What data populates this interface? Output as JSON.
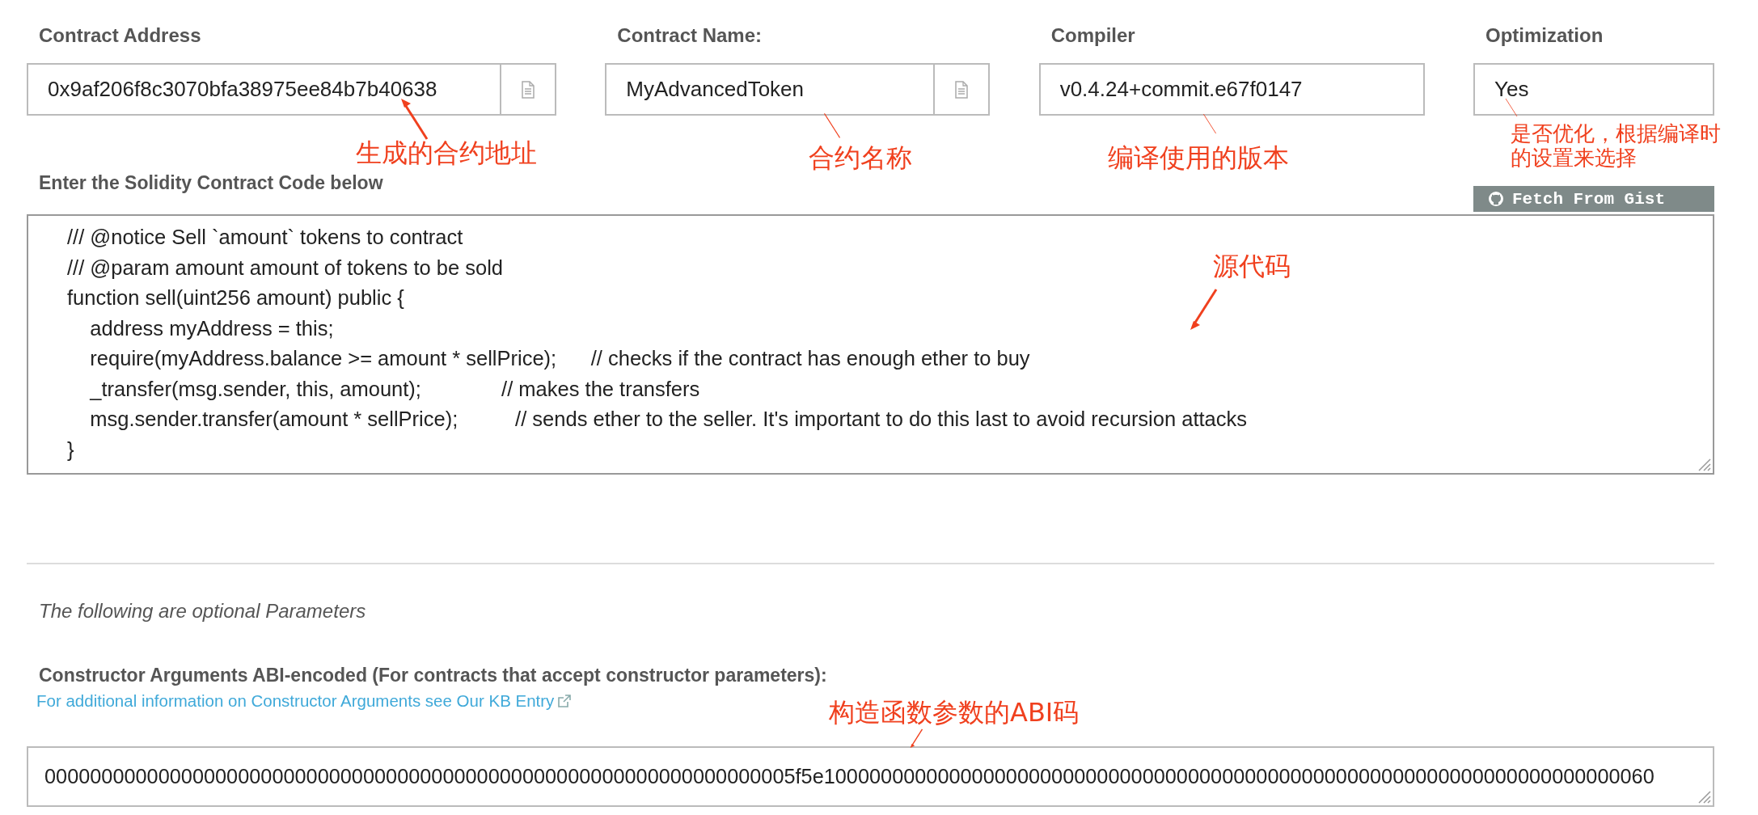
{
  "fields": [
    {
      "label": "Contract Address",
      "value": "0x9af206f8c3070bfa38975ee84b7b40638",
      "copy_button": true
    },
    {
      "label": "Contract Name:",
      "value": "MyAdvancedToken",
      "copy_button": true
    },
    {
      "label": "Compiler",
      "value": "v0.4.24+commit.e67f0147",
      "copy_button": false
    },
    {
      "label": "Optimization",
      "value": "Yes",
      "copy_button": false
    }
  ],
  "code_section": {
    "label": "Enter the Solidity Contract Code below",
    "gist_button": "Fetch From Gist",
    "lines": [
      "/// @notice Sell `amount` tokens to contract",
      "/// @param amount amount of tokens to be sold",
      "function sell(uint256 amount) public {",
      "    address myAddress = this;",
      "    require(myAddress.balance >= amount * sellPrice);      // checks if the contract has enough ether to buy",
      "    _transfer(msg.sender, this, amount);              // makes the transfers",
      "    msg.sender.transfer(amount * sellPrice);          // sends ether to the seller. It's important to do this last to avoid recursion attacks",
      "}"
    ]
  },
  "optional_note": "The following are optional Parameters",
  "constructor_args": {
    "label": "Constructor Arguments ABI-encoded (For contracts that accept constructor parameters):",
    "link": "For additional information on Constructor Arguments see Our KB Entry",
    "value": "000000000000000000000000000000000000000000000000000000000000000005f5e1000000000000000000000000000000000000000000000000000000000000000000000060"
  },
  "annotations": [
    {
      "text": "生成的合约地址"
    },
    {
      "text": "合约名称"
    },
    {
      "text": "编译使用的版本"
    },
    {
      "text": "是否优化，根据编译时的设置来选择"
    },
    {
      "text": "源代码"
    },
    {
      "text": "构造函数参数的ABI码"
    }
  ]
}
